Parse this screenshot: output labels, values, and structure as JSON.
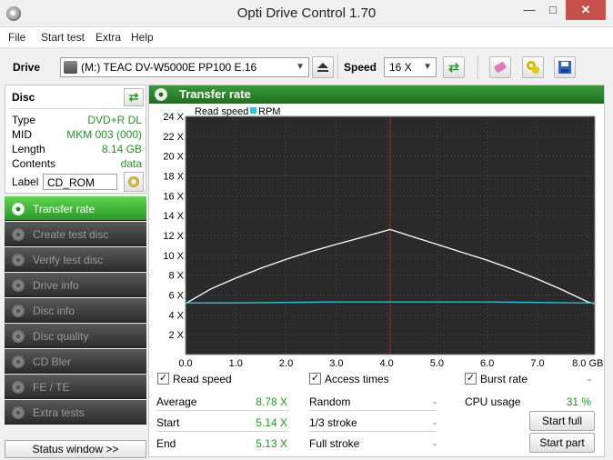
{
  "window": {
    "title": "Opti Drive Control 1.70",
    "minimize": "—",
    "maximize": "□",
    "close": "✕"
  },
  "menu": [
    "File",
    "Start test",
    "Extra",
    "Help"
  ],
  "toolbar": {
    "drive_label": "Drive",
    "drive_value": "(M:)  TEAC DV-W5000E PP100 E.16",
    "speed_label": "Speed",
    "speed_value": "16 X",
    "icons": [
      "eject-icon",
      "refresh-icon",
      "eraser-icon",
      "config-icon",
      "save-icon"
    ]
  },
  "disc": {
    "header": "Disc",
    "rows": [
      {
        "key": "Type",
        "value": "DVD+R DL"
      },
      {
        "key": "MID",
        "value": "MKM 003 (000)"
      },
      {
        "key": "Length",
        "value": "8.14 GB"
      },
      {
        "key": "Contents",
        "value": "data"
      }
    ],
    "label_key": "Label",
    "label_value": "CD_ROM"
  },
  "nav": [
    {
      "label": "Transfer rate",
      "active": true
    },
    {
      "label": "Create test disc",
      "active": false
    },
    {
      "label": "Verify test disc",
      "active": false
    },
    {
      "label": "Drive info",
      "active": false
    },
    {
      "label": "Disc info",
      "active": false
    },
    {
      "label": "Disc quality",
      "active": false
    },
    {
      "label": "CD Bler",
      "active": false
    },
    {
      "label": "FE / TE",
      "active": false
    },
    {
      "label": "Extra tests",
      "active": false
    }
  ],
  "status_window_button": "Status window >>",
  "panel": {
    "title": "Transfer rate"
  },
  "chart_data": {
    "type": "line",
    "legend": [
      "Read speed",
      "RPM"
    ],
    "ylim": [
      0,
      24
    ],
    "yticks": [
      "2 X",
      "4 X",
      "6 X",
      "8 X",
      "10 X",
      "12 X",
      "14 X",
      "16 X",
      "18 X",
      "20 X",
      "22 X",
      "24 X"
    ],
    "xlim": [
      0,
      8.14
    ],
    "xticks": [
      "0.0",
      "1.0",
      "2.0",
      "3.0",
      "4.0",
      "5.0",
      "6.0",
      "7.0",
      "8.0 GB"
    ],
    "layer_break_gb": 4.07,
    "end_gb": 8.14,
    "series": [
      {
        "name": "Read speed",
        "color": "#ffffff",
        "x": [
          0.0,
          0.5,
          1.0,
          1.5,
          2.0,
          2.5,
          3.0,
          3.5,
          4.0,
          4.07,
          4.5,
          5.0,
          5.5,
          6.0,
          6.5,
          7.0,
          7.5,
          8.0,
          8.14
        ],
        "y": [
          5.14,
          6.6,
          7.7,
          8.7,
          9.6,
          10.4,
          11.1,
          11.8,
          12.5,
          12.6,
          11.9,
          11.1,
          10.3,
          9.5,
          8.6,
          7.6,
          6.5,
          5.3,
          5.13
        ]
      },
      {
        "name": "RPM",
        "color": "#2fc4dc",
        "x": [
          0.0,
          1.0,
          2.0,
          3.0,
          4.0,
          4.07,
          5.0,
          6.0,
          7.0,
          8.0,
          8.14
        ],
        "y": [
          5.2,
          5.2,
          5.25,
          5.3,
          5.3,
          5.3,
          5.3,
          5.3,
          5.25,
          5.2,
          5.2
        ]
      }
    ]
  },
  "checks": {
    "read_speed": "Read speed",
    "access_times": "Access times",
    "burst_rate": "Burst rate",
    "burst_value": "-"
  },
  "stats": {
    "average_label": "Average",
    "average": "8.78 X",
    "start_label": "Start",
    "start": "5.14 X",
    "end_label": "End",
    "end": "5.13 X",
    "random_label": "Random",
    "random": "-",
    "third_label": "1/3 stroke",
    "third": "-",
    "full_label": "Full stroke",
    "full": "-",
    "cpu_label": "CPU usage",
    "cpu": "31 %"
  },
  "buttons": {
    "start_full": "Start full",
    "start_part": "Start part"
  }
}
